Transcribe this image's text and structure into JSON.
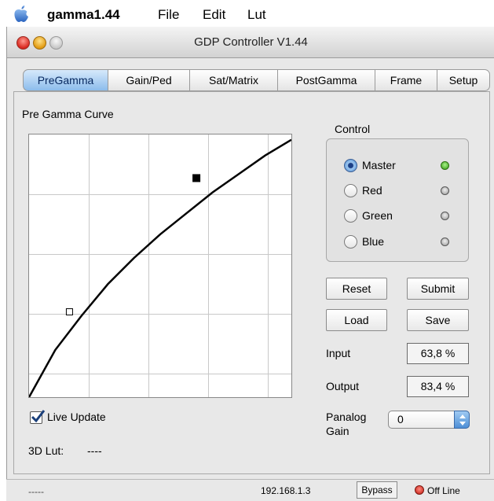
{
  "menubar": {
    "app_name": "gamma1.44",
    "items": [
      "File",
      "Edit",
      "Lut"
    ]
  },
  "window": {
    "title": "GDP Controller V1.44"
  },
  "tabs": [
    {
      "label": "PreGamma",
      "active": true
    },
    {
      "label": "Gain/Ped",
      "active": false
    },
    {
      "label": "Sat/Matrix",
      "active": false
    },
    {
      "label": "PostGamma",
      "active": false
    },
    {
      "label": "Frame",
      "active": false
    },
    {
      "label": "Setup",
      "active": false
    }
  ],
  "curve": {
    "title": "Pre Gamma Curve",
    "points": [
      [
        0,
        0
      ],
      [
        10,
        18
      ],
      [
        20,
        31
      ],
      [
        30,
        43
      ],
      [
        40,
        53
      ],
      [
        50,
        62
      ],
      [
        60,
        70
      ],
      [
        70,
        78
      ],
      [
        80,
        85
      ],
      [
        90,
        92
      ],
      [
        100,
        98
      ]
    ],
    "handles": [
      {
        "input": 15.4,
        "output": 32.5,
        "selected": false
      },
      {
        "input": 63.8,
        "output": 83.4,
        "selected": true
      }
    ]
  },
  "live_update": {
    "label": "Live Update",
    "checked": true
  },
  "lut": {
    "label": "3D Lut:",
    "value": "----"
  },
  "control": {
    "title": "Control",
    "channels": [
      {
        "label": "Master",
        "selected": true,
        "led_on": true
      },
      {
        "label": "Red",
        "selected": false,
        "led_on": false
      },
      {
        "label": "Green",
        "selected": false,
        "led_on": false
      },
      {
        "label": "Blue",
        "selected": false,
        "led_on": false
      }
    ]
  },
  "buttons": {
    "reset": "Reset",
    "submit": "Submit",
    "load": "Load",
    "save": "Save"
  },
  "readouts": {
    "input_label": "Input",
    "input_value": "63,8 %",
    "output_label": "Output",
    "output_value": "83,4 %"
  },
  "panalog": {
    "label_line1": "Panalog",
    "label_line2": "Gain",
    "value": "0"
  },
  "status": {
    "left": "-----",
    "ip": "192.168.1.3",
    "bypass": "Bypass",
    "state": "Off Line"
  },
  "colors": {
    "accent": "#8cbcec",
    "led_green": "#2f9d10",
    "status_red": "#c3150a"
  }
}
